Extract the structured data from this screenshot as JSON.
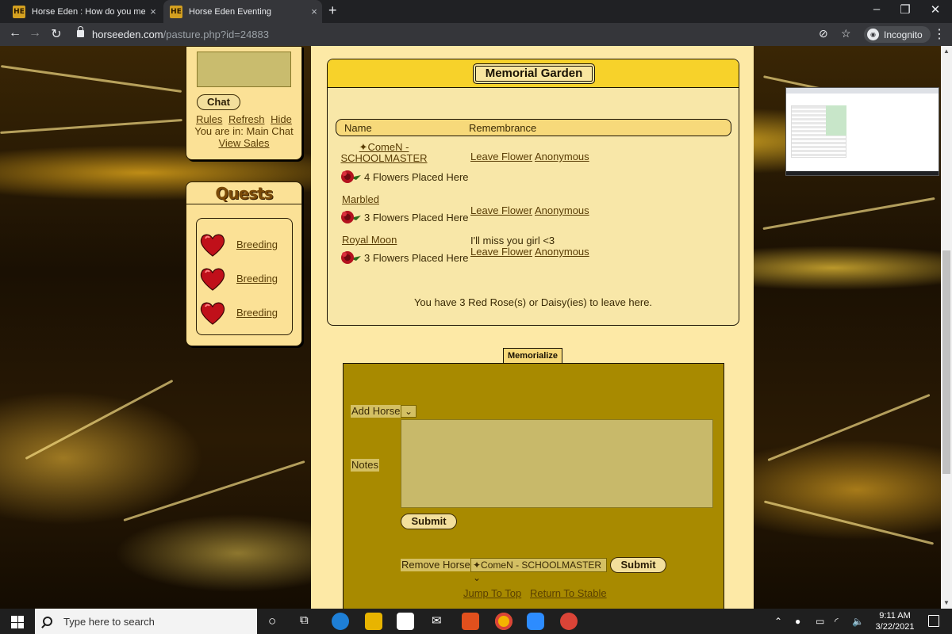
{
  "browser": {
    "tabs": [
      {
        "favicon": "HE",
        "title": "Horse Eden : How do you memo",
        "close": "×"
      },
      {
        "favicon": "HE",
        "title": "Horse Eden Eventing",
        "close": "×"
      }
    ],
    "new_tab": "+",
    "url_host": "horseeden.com",
    "url_path": "/pasture.php?id=24883",
    "incognito_label": "Incognito"
  },
  "chat": {
    "button_label": "Chat",
    "links": [
      "Rules",
      "Refresh",
      "Hide"
    ],
    "location_text": "You are in: Main Chat",
    "view_sales": "View Sales"
  },
  "quests": {
    "heading": "Quests",
    "items": [
      {
        "label": "Breeding",
        "icon": "heart-icon"
      },
      {
        "label": "Breeding",
        "icon": "heart-icon"
      },
      {
        "label": "Breeding",
        "icon": "heart-icon"
      }
    ]
  },
  "garden": {
    "title": "Memorial Garden",
    "columns": {
      "name": "Name",
      "remembrance": "Remembrance"
    },
    "rows": [
      {
        "name": "✦ComeN - SCHOOLMASTER",
        "flowers": "4 Flowers Placed Here",
        "note": "",
        "leave_flower": "Leave Flower",
        "anonymous": "Anonymous"
      },
      {
        "name": "Marbled",
        "flowers": "3 Flowers Placed Here",
        "note": "",
        "leave_flower": "Leave Flower",
        "anonymous": "Anonymous"
      },
      {
        "name": "Royal Moon",
        "flowers": "3 Flowers Placed Here",
        "note": "I'll miss you girl <3",
        "leave_flower": "Leave Flower",
        "anonymous": "Anonymous"
      }
    ],
    "roses_note": "You have 3 Red Rose(s) or Daisy(ies) to leave here."
  },
  "memorialize": {
    "tab_label": "Memorialize",
    "add_horse_label": "Add Horse",
    "add_horse_value": "",
    "notes_label": "Notes",
    "notes_value": "",
    "submit_label": "Submit",
    "remove_horse_label": "Remove Horse",
    "remove_horse_value": "✦ComeN - SCHOOLMASTER",
    "remove_submit_label": "Submit",
    "jump_to_top": "Jump To Top",
    "return_to_stable": "Return To Stable"
  },
  "taskbar": {
    "search_placeholder": "Type here to search",
    "time": "9:11 AM",
    "date": "3/22/2021"
  },
  "colors": {
    "panel_bg": "#fbe196",
    "header_yellow": "#f7d22a",
    "form_olive": "#a88a00",
    "link_brown": "#5a3d05",
    "heart_red": "#c0101a"
  }
}
